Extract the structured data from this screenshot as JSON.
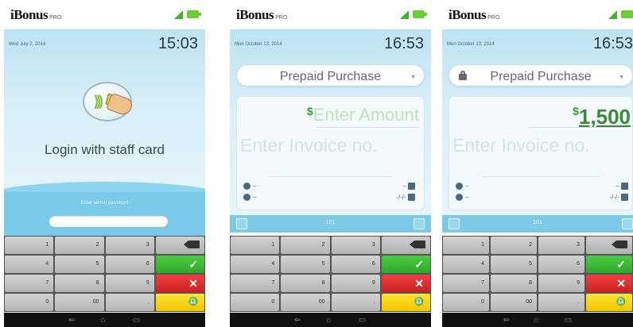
{
  "brand": {
    "name": "iBonus",
    "suffix": "PRO"
  },
  "screen1": {
    "date": "Wed July 2, 2014",
    "time": "15:03",
    "login_text": "Login with staff card",
    "admin_label": "Enter admin password",
    "admin_value": ""
  },
  "screen2": {
    "date": "Mon October 13, 2014",
    "time": "16:53",
    "purchase_type": "Prepaid Purchase",
    "currency": "$",
    "amount_placeholder": "Enter Amount",
    "invoice_placeholder": "Enter Invoice no.",
    "meta": {
      "left1": "–",
      "left2": "–",
      "right1": "–",
      "right2": "-/-/-"
    },
    "toolbar_label": "101"
  },
  "screen3": {
    "date": "Mon October 13, 2014",
    "time": "16:53",
    "purchase_type": "Prepaid Purchase",
    "currency": "$",
    "amount": "1,500",
    "invoice_placeholder": "Enter Invoice no.",
    "meta": {
      "left1": "–",
      "left2": "–",
      "right1": "–",
      "right2": "-/-/-"
    },
    "toolbar_label": "101"
  },
  "keypad": {
    "k1": "1",
    "k2": "2",
    "k3": "3",
    "k4": "4",
    "k5": "5",
    "k6": "6",
    "k7": "7",
    "k8": "8",
    "k9": "9",
    "k0": "0",
    "k00": "00",
    "kdot": ".",
    "ok": "✓",
    "cancel": "✕",
    "fn": "♎"
  },
  "nav": {
    "back": "⇐",
    "home": "⌂",
    "recent": "▭"
  },
  "colors": {
    "accent": "#7dcae6",
    "ok": "#2ea82a",
    "cancel": "#cc2222",
    "fn": "#f2c400",
    "amount": "#3a8a3a"
  }
}
